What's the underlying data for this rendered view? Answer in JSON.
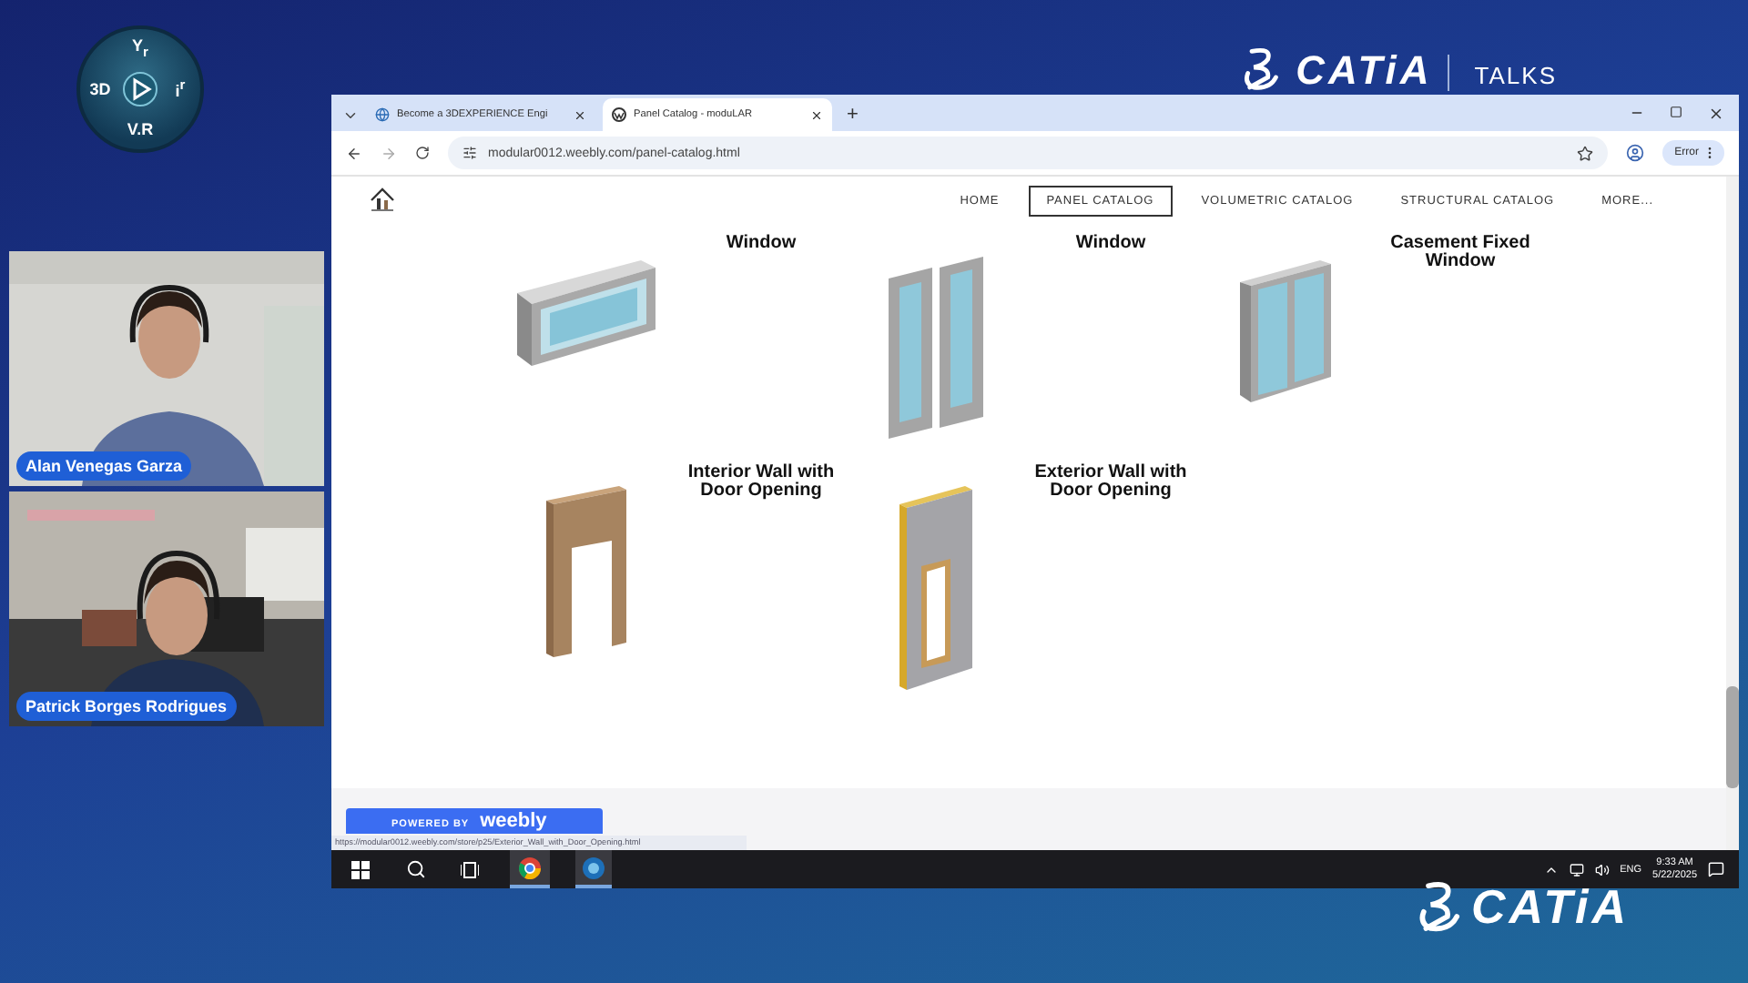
{
  "channel_logo": {
    "labels": [
      "Y$_{r}$",
      "3D",
      "i$^{r}$",
      "V.R"
    ]
  },
  "brand_header": {
    "brand": "CATiA",
    "show": "TALKS"
  },
  "participants": [
    {
      "name": "Alan Venegas Garza",
      "kind": "light-room"
    },
    {
      "name": "Patrick Borges Rodrigues",
      "kind": "office"
    }
  ],
  "browser": {
    "tabs": [
      {
        "title": "Become a 3DEXPERIENCE Engi",
        "selected": false
      },
      {
        "title": "Panel Catalog - moduLAR",
        "selected": true
      }
    ],
    "new_tab": "+",
    "url": "modular0012.weebly.com/panel-catalog.html",
    "profile_button": "Error"
  },
  "site": {
    "nav": [
      {
        "label": "HOME",
        "selected": false
      },
      {
        "label": "PANEL CATALOG",
        "selected": true
      },
      {
        "label": "VOLUMETRIC CATALOG",
        "selected": false
      },
      {
        "label": "STRUCTURAL CATALOG",
        "selected": false
      },
      {
        "label": "MORE...",
        "selected": false
      }
    ],
    "products": [
      {
        "title": "Window",
        "kind": "horizontal-window"
      },
      {
        "title": "Window",
        "kind": "double-window"
      },
      {
        "title": "Casement Fixed Window",
        "kind": "casement-window"
      },
      {
        "title": "Interior Wall with Door Opening",
        "kind": "interior-door-wall"
      },
      {
        "title": "Exterior Wall with Door Opening",
        "kind": "exterior-door-wall"
      }
    ],
    "footer_badge": {
      "prefix": "POWERED BY",
      "brand": "weebly"
    },
    "status_url": "https://modular0012.weebly.com/store/p25/Exterior_Wall_with_Door_Opening.html"
  },
  "taskbar": {
    "language": "ENG",
    "time": "9:33 AM",
    "date": "5/22/2025"
  },
  "footer_brand": "CATiA"
}
